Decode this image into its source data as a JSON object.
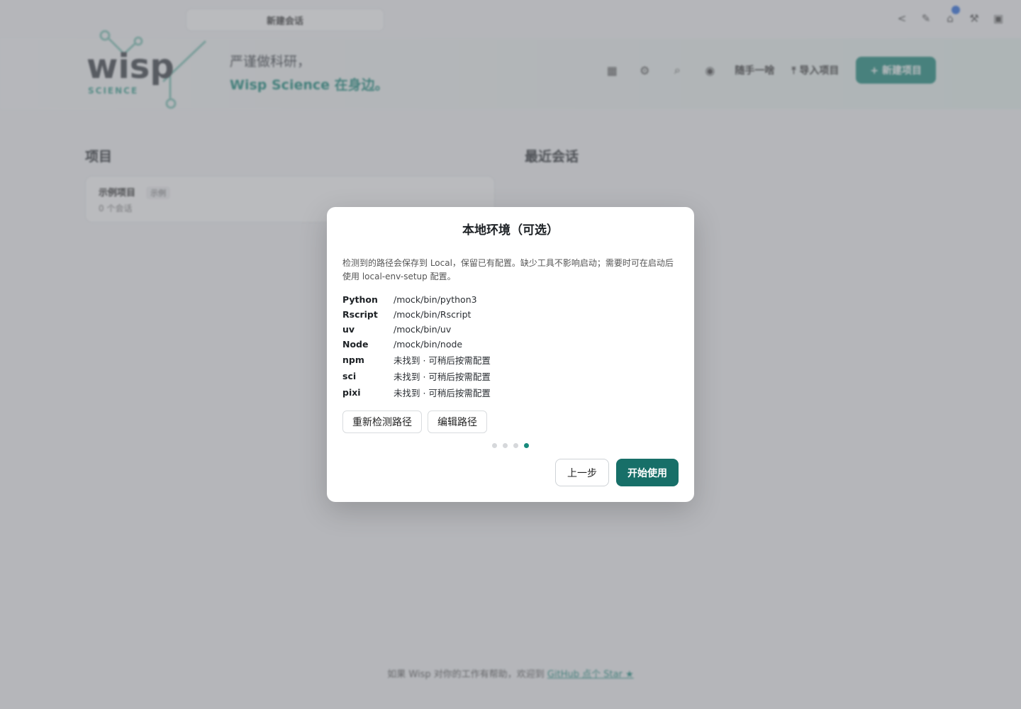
{
  "app": {
    "topbar": {
      "search_label": "新建会话"
    },
    "tagline": {
      "line1": "严谨做科研，",
      "line2": "Wisp Science 在身边。"
    },
    "header_actions": {
      "random_label": "随手一啥",
      "import_label": "导入项目",
      "new_project_label": "+ 新建项目"
    },
    "projects": {
      "title": "项目",
      "items": [
        {
          "name": "示例项目",
          "tag": "示例",
          "count": "0 个会话"
        }
      ]
    },
    "recent": {
      "title": "最近会话"
    },
    "footer": {
      "text": "如果 Wisp 对你的工作有帮助，欢迎到",
      "link": "GitHub 点个 Star ★"
    }
  },
  "modal": {
    "title": "本地环境（可选）",
    "description": "检测到的路径会保存到 Local，保留已有配置。缺少工具不影响启动；需要时可在启动后使用 local-env-setup 配置。",
    "env": [
      {
        "key": "Python",
        "value": "/mock/bin/python3"
      },
      {
        "key": "Rscript",
        "value": "/mock/bin/Rscript"
      },
      {
        "key": "uv",
        "value": "/mock/bin/uv"
      },
      {
        "key": "Node",
        "value": "/mock/bin/node"
      },
      {
        "key": "npm",
        "value": "未找到 · 可稍后按需配置"
      },
      {
        "key": "sci",
        "value": "未找到 · 可稍后按需配置"
      },
      {
        "key": "pixi",
        "value": "未找到 · 可稍后按需配置"
      }
    ],
    "actions": {
      "redetect": "重新检测路径",
      "edit": "编辑路径"
    },
    "steps": {
      "total": 4,
      "current": 4
    },
    "footer": {
      "prev": "上一步",
      "start": "开始使用"
    }
  },
  "colors": {
    "accent": "#176f68",
    "brand": "#1b8a7c",
    "badge": "#2b6de0"
  }
}
